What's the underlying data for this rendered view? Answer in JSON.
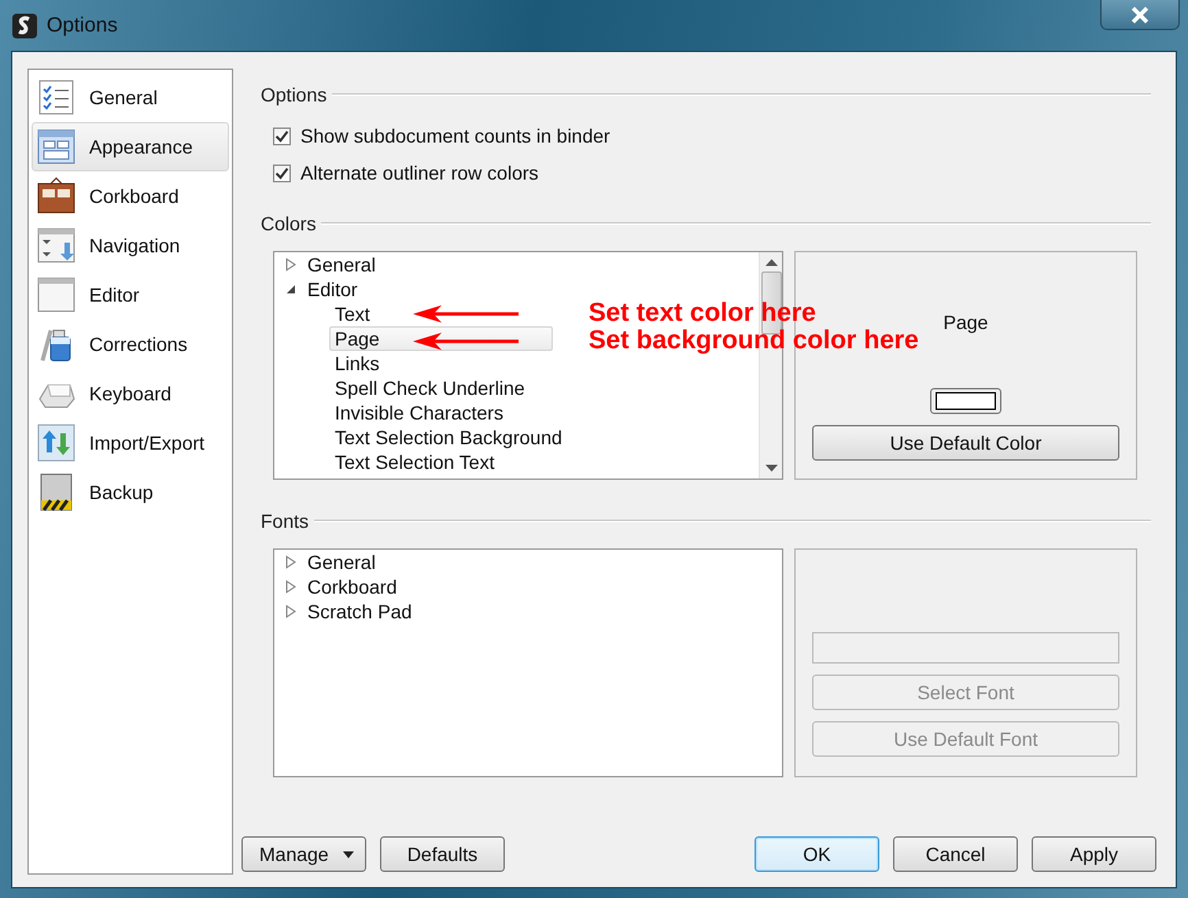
{
  "window": {
    "title": "Options"
  },
  "sidebar": {
    "items": [
      {
        "label": "General",
        "selected": false
      },
      {
        "label": "Appearance",
        "selected": true
      },
      {
        "label": "Corkboard",
        "selected": false
      },
      {
        "label": "Navigation",
        "selected": false
      },
      {
        "label": "Editor",
        "selected": false
      },
      {
        "label": "Corrections",
        "selected": false
      },
      {
        "label": "Keyboard",
        "selected": false
      },
      {
        "label": "Import/Export",
        "selected": false
      },
      {
        "label": "Backup",
        "selected": false
      }
    ]
  },
  "options": {
    "heading": "Options",
    "checkboxes": [
      {
        "label": "Show subdocument counts in binder",
        "checked": true
      },
      {
        "label": "Alternate outliner row colors",
        "checked": true
      }
    ]
  },
  "colors": {
    "heading": "Colors",
    "tree": [
      {
        "label": "General",
        "expanded": false,
        "selected": false
      },
      {
        "label": "Editor",
        "expanded": true,
        "selected": false,
        "children": [
          {
            "label": "Text",
            "selected": false
          },
          {
            "label": "Page",
            "selected": true
          },
          {
            "label": "Links",
            "selected": false
          },
          {
            "label": "Spell Check Underline",
            "selected": false
          },
          {
            "label": "Invisible Characters",
            "selected": false
          },
          {
            "label": "Text Selection Background",
            "selected": false
          },
          {
            "label": "Text Selection Text",
            "selected": false
          }
        ]
      }
    ],
    "preview_label": "Page",
    "default_button": {
      "label": "Use Default Color",
      "disabled": false
    }
  },
  "fonts": {
    "heading": "Fonts",
    "tree": [
      {
        "label": "General",
        "expanded": false,
        "selected": false
      },
      {
        "label": "Corkboard",
        "expanded": false,
        "selected": false
      },
      {
        "label": "Scratch Pad",
        "expanded": false,
        "selected": false
      }
    ],
    "font_field": {
      "disabled": true
    },
    "buttons": [
      {
        "label": "Select Font",
        "disabled": true
      },
      {
        "label": "Use Default Font",
        "disabled": true
      }
    ]
  },
  "footer": {
    "left_buttons": [
      {
        "label": "Manage",
        "kind": "menu"
      },
      {
        "label": "Defaults",
        "kind": "plain"
      }
    ],
    "right_buttons": [
      {
        "label": "OK",
        "default": true
      },
      {
        "label": "Cancel",
        "default": false
      },
      {
        "label": "Apply",
        "default": false
      }
    ]
  },
  "annotations": [
    {
      "text": "Set text color here"
    },
    {
      "text": "Set background color here"
    }
  ]
}
